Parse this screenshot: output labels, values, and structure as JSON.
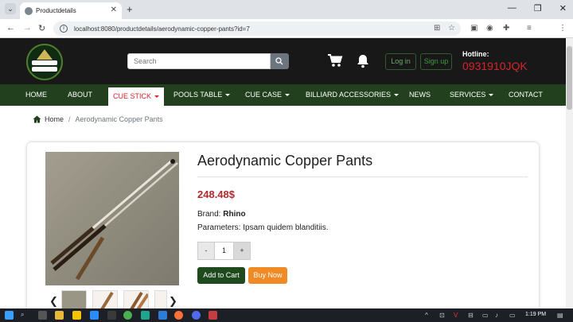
{
  "browser": {
    "tab_title": "Productdetails",
    "tab_close": "✕",
    "new_tab": "+",
    "url": "localhost:8080/productdetails/aerodynamic-copper-pants?id=7",
    "window_buttons": [
      "—",
      "❐",
      "✕"
    ]
  },
  "header": {
    "search_placeholder": "Search",
    "login_label": "Log in",
    "signup_label": "Sign up",
    "hotline_label": "Hotline:",
    "hotline_number": "0931910JQK"
  },
  "nav": {
    "items": [
      {
        "label": "HOME"
      },
      {
        "label": "ABOUT"
      },
      {
        "label": "CUE STICK"
      },
      {
        "label": "POOLS TABLE"
      },
      {
        "label": "CUE CASE"
      },
      {
        "label": "BILLIARD ACCESSORIES"
      },
      {
        "label": "NEWS"
      },
      {
        "label": "SERVICES"
      },
      {
        "label": "CONTACT"
      }
    ]
  },
  "breadcrumb": {
    "home": "Home",
    "separator": "/",
    "current": "Aerodynamic Copper Pants"
  },
  "product": {
    "title": "Aerodynamic Copper Pants",
    "price": "248.48$",
    "brand_label": "Brand:",
    "brand": "Rhino",
    "params_label": "Parameters:",
    "params": "Ipsam quidem blanditiis.",
    "qty_minus": "-",
    "qty": "1",
    "qty_plus": "+",
    "add_to_cart": "Add to Cart",
    "buy_now": "Buy Now"
  },
  "thumbnails": {
    "prev": "❮",
    "next": "❯"
  },
  "taskbar": {
    "time": "1:19 PM"
  },
  "colors": {
    "topbar": "#181818",
    "menu": "#22401d",
    "price": "#b5282b",
    "hotline": "#d6242b",
    "buy": "#f08a24",
    "cart_btn": "#1f4a1d"
  }
}
